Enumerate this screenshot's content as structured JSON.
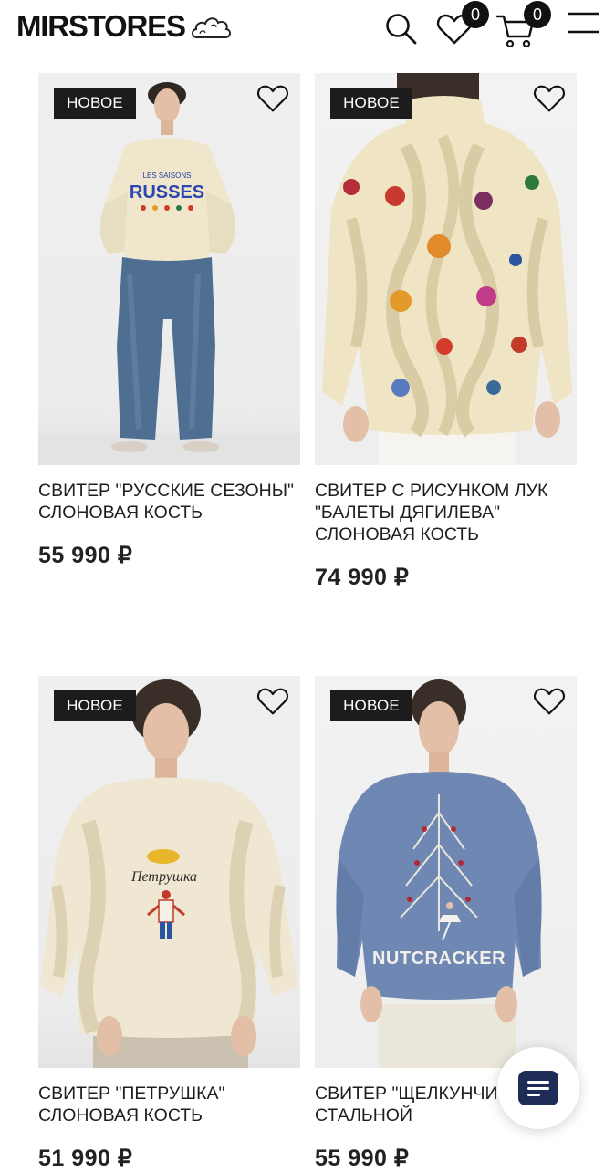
{
  "header": {
    "logo_text": "MIRSTORES",
    "wishlist_count": "0",
    "cart_count": "0"
  },
  "products": [
    {
      "tag": "НОВОЕ",
      "title": "СВИТЕР \"РУССКИЕ СЕЗОНЫ\" СЛОНОВАЯ КОСТЬ",
      "price": "55 990 ₽",
      "print_text": "LES SAISONS RUSSES"
    },
    {
      "tag": "НОВОЕ",
      "title": "СВИТЕР С РИСУНКОМ ЛУК \"БАЛЕТЫ ДЯГИЛЕВА\" СЛОНОВАЯ КОСТЬ",
      "price": "74 990 ₽"
    },
    {
      "tag": "НОВОЕ",
      "title": "СВИТЕР \"ПЕТРУШКА\" СЛОНОВАЯ КОСТЬ",
      "price": "51 990 ₽",
      "print_text": "Петрушка"
    },
    {
      "tag": "НОВОЕ",
      "title": "СВИТЕР \"ЩЕЛКУНЧИ СТАЛЬНОЙ",
      "price": "55 990 ₽",
      "print_text": "NUTCRACKER"
    }
  ],
  "icons": {
    "search": "search-icon",
    "wishlist": "heart-icon",
    "cart": "cart-icon",
    "menu": "hamburger-menu-icon",
    "favorite": "heart-outline-icon",
    "chat": "chat-icon"
  },
  "colors": {
    "tag_bg": "#1c1c1c",
    "badge_bg": "#111111",
    "chat_accent": "#1f2c58",
    "ivory_knit": "#efe7cf",
    "blue_knit": "#6f87b3"
  }
}
